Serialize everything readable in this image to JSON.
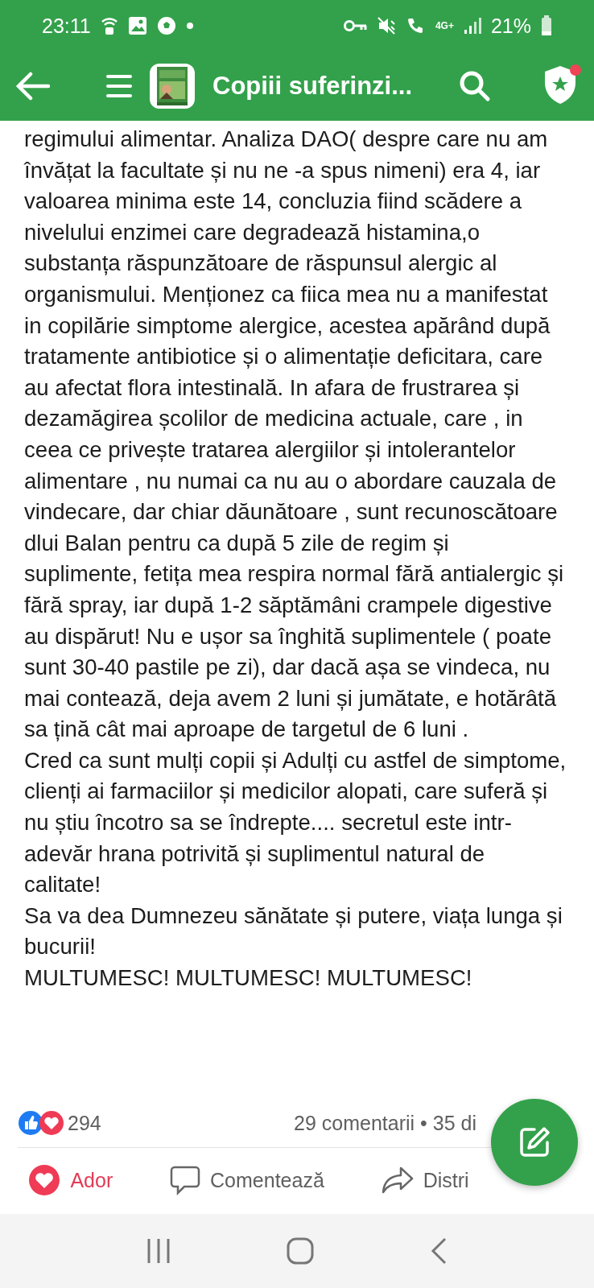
{
  "status_bar": {
    "time": "23:11",
    "network": "4G+",
    "battery": "21%"
  },
  "header": {
    "title": "Copiii suferinzi...",
    "notification_dot": true
  },
  "post": {
    "paragraphs": [
      "regimului alimentar. Analiza DAO( despre care nu am învățat la facultate și nu ne -a spus nimeni) era 4, iar valoarea minima este 14, concluzia fiind scădere a nivelului enzimei care degradează histamina,o substanța răspunzătoare de răspunsul alergic al organismului. Menționez ca fiica mea nu a manifestat in copilărie simptome alergice, acestea apărând după tratamente antibiotice și o alimentație deficitara, care au afectat flora intestinală. In afara de frustrarea și dezamăgirea școlilor de medicina actuale, care , in ceea ce privește tratarea alergiilor și intolerantelor alimentare , nu numai ca nu au o abordare cauzala de vindecare, dar chiar dăunătoare , sunt recunoscătoare dlui Balan pentru ca după 5 zile de regim și suplimente, fetița mea respira normal fără antialergic și fără spray, iar după 1-2 săptămâni crampele digestive au dispărut! Nu e ușor sa înghită suplimentele ( poate sunt 30-40 pastile pe zi), dar dacă așa se vindeca, nu mai contează, deja avem 2 luni și jumătate, e hotărâtă sa țină cât mai aproape de targetul de 6 luni .",
      "Cred ca sunt mulți copii și Adulți cu astfel de simptome, clienți ai farmaciilor și medicilor alopati, care suferă și nu știu încotro sa se îndrepte.... secretul este intr-adevăr hrana potrivită și suplimentul natural de calitate!",
      "Sa va dea Dumnezeu sănătate și putere, viața lunga și bucurii!",
      "MULTUMESC! MULTUMESC! MULTUMESC!"
    ]
  },
  "reactions": {
    "count": "294",
    "comments": "29 comentarii • 35 di"
  },
  "actions": [
    {
      "kind": "love",
      "label": "Ador",
      "selected": true
    },
    {
      "kind": "comment",
      "label": "Comentează",
      "selected": false
    },
    {
      "kind": "share",
      "label": "Distri",
      "selected": false
    }
  ]
}
